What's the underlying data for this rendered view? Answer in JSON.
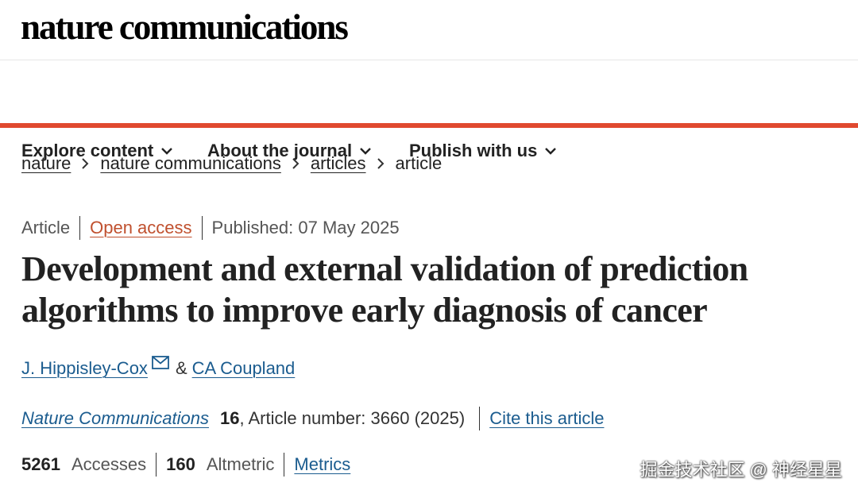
{
  "site": {
    "logo_text": "nature communications"
  },
  "nav": {
    "items": [
      {
        "label": "Explore content"
      },
      {
        "label": "About the journal"
      },
      {
        "label": "Publish with us"
      }
    ]
  },
  "breadcrumb": {
    "items": [
      "nature",
      "nature communications",
      "articles"
    ],
    "current": "article"
  },
  "article": {
    "type": "Article",
    "access": "Open access",
    "published": "Published: 07 May 2025",
    "title": "Development and external validation of prediction algorithms to improve early diagnosis of cancer",
    "authors": [
      "J. Hippisley-Cox",
      "CA Coupland"
    ],
    "author_separator": "&",
    "journal": "Nature Communications",
    "volume": "16",
    "article_number_text": ", Article number: 3660 (2025)",
    "cite_label": "Cite this article",
    "metrics": {
      "accesses_value": "5261",
      "accesses_label": "Accesses",
      "altmetric_value": "160",
      "altmetric_label": "Altmetric",
      "metrics_link": "Metrics"
    }
  },
  "watermark": "掘金技术社区 @ 神经星星",
  "icons": {
    "mail": "mail-icon",
    "nav_dropdown": "chevron-down-icon",
    "crumb_separator": "chevron-right-icon"
  },
  "colors": {
    "accent_red": "#e0492f",
    "link_blue": "#1b5c8f",
    "open_access": "#c0502e"
  }
}
